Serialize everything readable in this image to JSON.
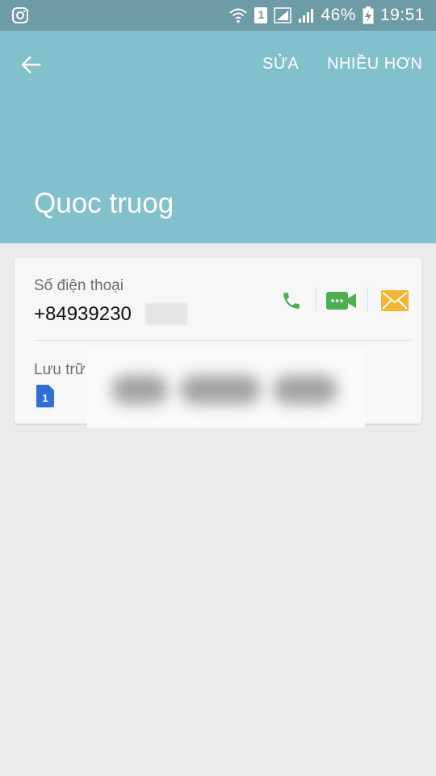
{
  "status_bar": {
    "battery": "46%",
    "time": "19:51",
    "sim_slot": "1",
    "icons": [
      "instagram-icon",
      "wifi-icon",
      "sim-1-icon",
      "signal-icon",
      "signal-icon",
      "battery-charging-icon"
    ]
  },
  "toolbar": {
    "back_icon": "arrow-back-icon",
    "edit_label": "SỬA",
    "more_label": "NHIỀU HƠN"
  },
  "contact": {
    "name": "Quoc truog",
    "phone_label": "Số điện thoại",
    "phone_number_visible": "+84939230",
    "storage_label": "Lưu trữ",
    "storage_sim": "1"
  },
  "colors": {
    "status_bar": "#6e9ca6",
    "app_bar": "#82c0cc",
    "call": "#4caf50",
    "video": "#4caf50",
    "message": "#f2b632",
    "sim": "#2f6fd6"
  }
}
